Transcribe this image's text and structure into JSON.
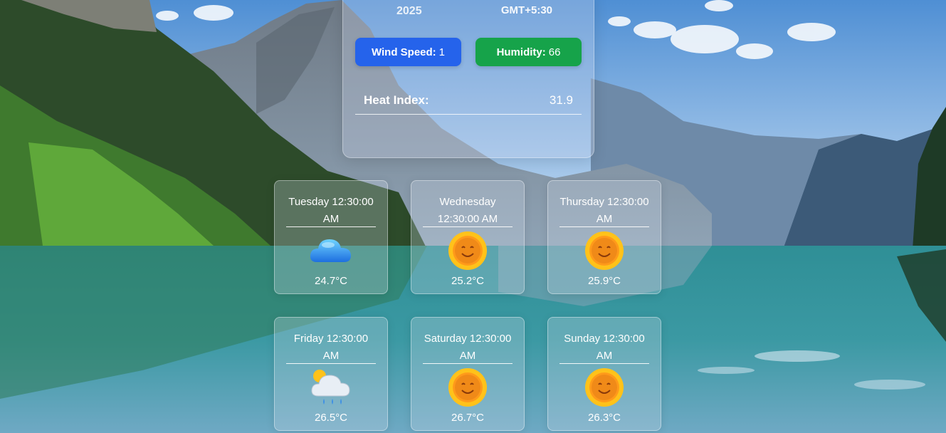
{
  "header": {
    "year": "2025",
    "timezone": "GMT+5:30"
  },
  "stats": {
    "wind_label": "Wind Speed:",
    "wind_value": "1",
    "humidity_label": "Humidity:",
    "humidity_value": "66",
    "heat_index_label": "Heat Index:",
    "heat_index_value": "31.9"
  },
  "colors": {
    "wind_pill": "#2563eb",
    "humidity_pill": "#16a34a"
  },
  "forecast": [
    {
      "day": "Tuesday 12:30:00 AM",
      "icon": "cloud-icon",
      "temp": "24.7°C"
    },
    {
      "day": "Wednesday 12:30:00 AM",
      "icon": "sun-icon",
      "temp": "25.2°C"
    },
    {
      "day": "Thursday 12:30:00 AM",
      "icon": "sun-icon",
      "temp": "25.9°C"
    },
    {
      "day": "Friday 12:30:00 AM",
      "icon": "rain-cloud-icon",
      "temp": "26.5°C"
    },
    {
      "day": "Saturday 12:30:00 AM",
      "icon": "sun-icon",
      "temp": "26.7°C"
    },
    {
      "day": "Sunday 12:30:00 AM",
      "icon": "sun-icon",
      "temp": "26.3°C"
    }
  ]
}
